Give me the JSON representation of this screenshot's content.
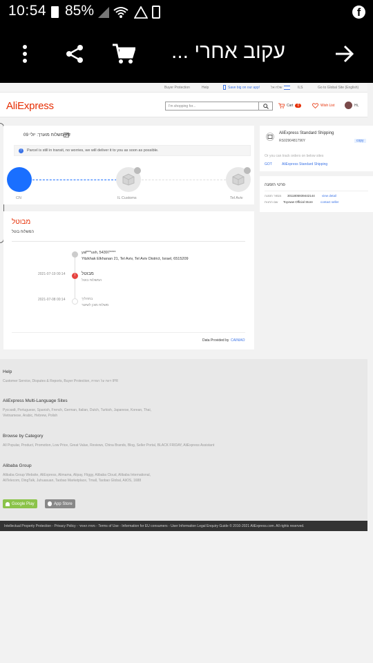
{
  "status_bar": {
    "time": "10:54",
    "battery": "85%"
  },
  "app_toolbar": {
    "title": "עקוב אחרי ...",
    "icons": [
      "more-vert-icon",
      "share-icon",
      "cart-icon",
      "arrow-forward-icon"
    ]
  },
  "topbar": {
    "buyer_protection": "Buyer Protection",
    "help": "Help",
    "save_big": "Save big on our app!",
    "ship_to": "שלח אל",
    "lang": "ILS",
    "global_site": "Go to Global Site (English)"
  },
  "header": {
    "logo": "AliExpress",
    "search_placeholder": "I'm shopping for...",
    "cart_label": "Cart",
    "cart_count": "0",
    "wishlist": "Wish List",
    "user": "Hi,"
  },
  "delivery": {
    "title": "זמן משלוח מוערך: יולי 09",
    "notice": "Parcel is still in transit, no worries, we will deliver it to you as soon as possible.",
    "steps": [
      {
        "label": "CN"
      },
      {
        "label": "IL Customs"
      },
      {
        "label": "Tel Aviv"
      }
    ]
  },
  "order_status": {
    "title": "מבוטל",
    "subtitle": "המשלוח בוטל",
    "recipient_name": "yaf***ush,  54397****",
    "recipient_address": "Yitzkhak Elkhanan 21,  Tel Aviv,  Tel Aviv District,  Israel,  6515209",
    "events": [
      {
        "date": "2021-07-19 00:14",
        "title": "מבוטל",
        "desc": "המשלוח בוטל"
      },
      {
        "date": "2021-07-08 00:14",
        "title": "בתהליך",
        "desc": "משלוח מוכן לשיגור"
      }
    ],
    "data_provided": "Data Provided by",
    "provider": "CAINIAO"
  },
  "shipping_card": {
    "method": "AliExpress Standard Shipping",
    "tracking": "RS0290481796Y",
    "copy": "copy",
    "track_hint": "Or you can track orders on below sites",
    "link1": "GOT",
    "link2": "AliExpress Standard Shipping"
  },
  "order_details": {
    "title": "פרטי הזמנה",
    "order_no_label": "מספר הזמנה",
    "order_no": "3011805939442144",
    "view_detail": "view detail",
    "store_label": "שם החנות",
    "store": "Toyoww Official Store",
    "contact": "contact seller"
  },
  "footer": {
    "help_title": "Help",
    "help_links": "Customer Service, Disputes & Reports, Buyer Protection, דווח על הפרת IPR",
    "multi_title": "AliExpress Multi-Language Sites",
    "multi_line1": "Русский, Portuguese, Spanish, French, German, Italian, Dutch, Turkish, Japanese, Korean, Thai,",
    "multi_line2": "Vietnamese, Arabic, Hebrew, Polish",
    "browse_title": "Browse by Category",
    "browse_links": "All Popular, Product, Promotion, Low Price, Great Value, Reviews, China Brands, Blog, Seller Portal, BLACK FRIDAY, AliExpress Assistant",
    "group_title": "Alibaba Group",
    "group_line1": "Alibaba Group Website, AliExpress, Alimama, Alipay, Fliggy, Alibaba Cloud, Alibaba International,",
    "group_line2": "AliTelecom, DingTalk, Juhuasuan, Taobao Marketplace, Tmall, Taobao Global, AliOS, 1688",
    "google_play": "Google Play",
    "app_store": "App Store",
    "bottom": "Intellectual Property Protection - Privacy Policy - מפת האתר - Terms of Use - Information for EU consumers - User Information Legal Enquiry Guide  © 2010-2021 AliExpress.com. All rights reserved."
  },
  "colors": {
    "brand": "#e62e04",
    "accent_blue": "#1a6fff",
    "status_red": "#e64340"
  }
}
